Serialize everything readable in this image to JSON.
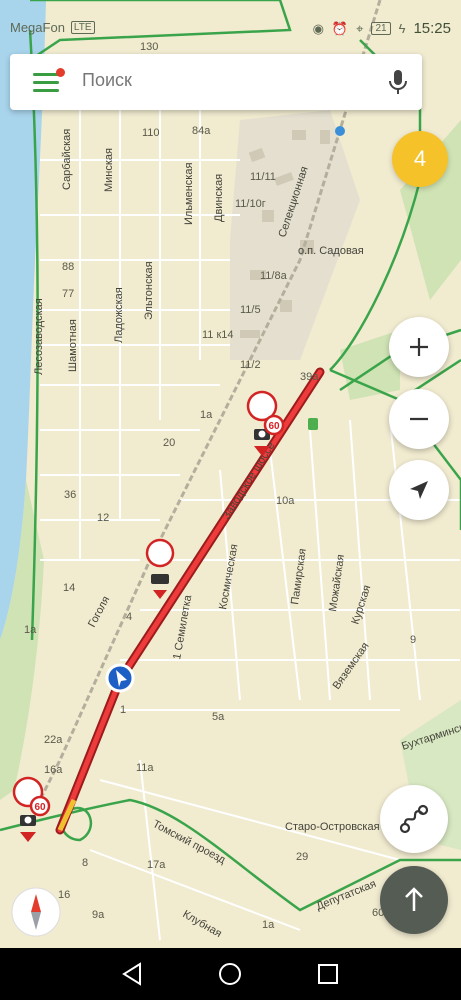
{
  "status_bar": {
    "carrier": "MegaFon",
    "carrier_badge": "LTE",
    "battery": "21",
    "time": "15:25"
  },
  "search": {
    "placeholder": "Поиск"
  },
  "traffic_score": "4",
  "streets": {
    "sarbayskaya": "Сарбайская",
    "minskaya": "Минская",
    "ilmenskaya": "Ильменская",
    "dvinskaya": "Двинская",
    "selektsionnaya": "Селекционная",
    "lesozavodskaya": "Лесозаводская",
    "shamotnaya": "Шамотная",
    "ladozhskaya": "Ладожская",
    "eltonskaya": "Эльтонская",
    "zavodskoe_shosse": "Заводское шоссе",
    "gogolya": "Гоголя",
    "semiletka": "1 Семилетка",
    "kosmicheskaya": "Космическая",
    "pamirskaya": "Памирская",
    "mozhayskaya": "Можайская",
    "kurskaya": "Курская",
    "vyazemskaya": "Вяземская",
    "bukhtarminskaya": "Бухтарминская",
    "staro_ostrovskaya": "Старо-Островская",
    "tomsky_proezd": "Томский проезд",
    "deputatskaya": "Депутатская",
    "klubnaya": "Клубная",
    "op_sadovaya": "о.п. Садовая"
  },
  "house_numbers": {
    "n130": "130",
    "n110": "110",
    "n84a": "84а",
    "n11_11": "11/11",
    "n11_10g": "11/10г",
    "n88": "88",
    "n77": "77",
    "n11_8a": "11/8а",
    "n11_5": "11/5",
    "n11k14": "11 к14",
    "n11_2": "11/2",
    "n39a": "39а",
    "n1a_top": "1а",
    "n20": "20",
    "n36": "36",
    "n12": "12",
    "n10a": "10а",
    "n14": "14",
    "n1a_left": "1а",
    "n4": "4",
    "n9": "9",
    "n1": "1",
    "n5a": "5а",
    "n22a": "22а",
    "n16a": "16а",
    "n11a": "11а",
    "n29": "29",
    "n8": "8",
    "n17a": "17а",
    "n16": "16",
    "n9a": "9а",
    "n1a_bottom": "1а",
    "n60b": "60в"
  },
  "speed_limits": {
    "cam_top": "60",
    "cam_bottom": "60"
  }
}
